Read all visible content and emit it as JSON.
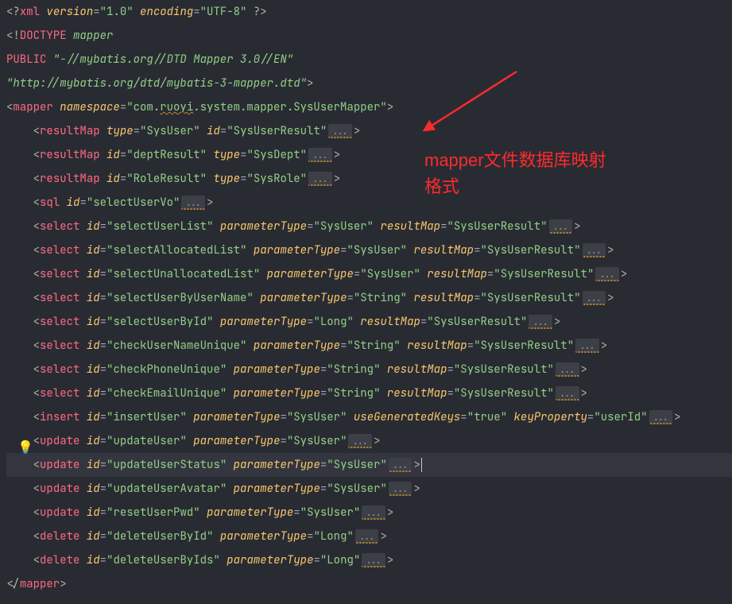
{
  "annotation": {
    "text_line1": "mapper文件数据库映射",
    "text_line2": "格式"
  },
  "bulb": "💡",
  "code": {
    "l1": {
      "pre": "<?",
      "tag": "xml",
      "a1": "version",
      "v1": "\"1.0\"",
      "a2": "encoding",
      "v2": "\"UTF-8\"",
      "post": " ?>"
    },
    "l2": {
      "open": "<!",
      "kw": "DOCTYPE",
      "val": "mapper"
    },
    "l3": {
      "kw": "PUBLIC",
      "val": "\"-//mybatis.org//DTD Mapper 3.0//EN\""
    },
    "l4": {
      "val": "\"http://mybatis.org/dtd/mybatis-3-mapper.dtd\"",
      "close": ">"
    },
    "l5": {
      "open": "<",
      "tag": "mapper",
      "a1": "namespace",
      "v1p": "\"com.",
      "v1w": "ruoyi",
      "v1s": ".system.mapper.SysUserMapper\"",
      "close": ">"
    },
    "l6": {
      "tag": "resultMap",
      "a1": "type",
      "v1": "\"SysUser\"",
      "a2": "id",
      "v2": "\"SysUserResult\"",
      "fold": "..."
    },
    "l7": {
      "tag": "resultMap",
      "a1": "id",
      "v1": "\"deptResult\"",
      "a2": "type",
      "v2": "\"SysDept\"",
      "fold": "..."
    },
    "l8": {
      "tag": "resultMap",
      "a1": "id",
      "v1": "\"RoleResult\"",
      "a2": "type",
      "v2": "\"SysRole\"",
      "fold": "..."
    },
    "l9": {
      "tag": "sql",
      "a1": "id",
      "v1": "\"selectUserVo\"",
      "fold": "..."
    },
    "l10": {
      "tag": "select",
      "a1": "id",
      "v1": "\"selectUserList\"",
      "a2": "parameterType",
      "v2": "\"SysUser\"",
      "a3": "resultMap",
      "v3": "\"SysUserResult\"",
      "fold": "..."
    },
    "l11": {
      "tag": "select",
      "a1": "id",
      "v1": "\"selectAllocatedList\"",
      "a2": "parameterType",
      "v2": "\"SysUser\"",
      "a3": "resultMap",
      "v3": "\"SysUserResult\"",
      "fold": "..."
    },
    "l12": {
      "tag": "select",
      "a1": "id",
      "v1": "\"selectUnallocatedList\"",
      "a2": "parameterType",
      "v2": "\"SysUser\"",
      "a3": "resultMap",
      "v3": "\"SysUserResult\"",
      "fold": "..."
    },
    "l13": {
      "tag": "select",
      "a1": "id",
      "v1": "\"selectUserByUserName\"",
      "a2": "parameterType",
      "v2": "\"String\"",
      "a3": "resultMap",
      "v3": "\"SysUserResult\"",
      "fold": "..."
    },
    "l14": {
      "tag": "select",
      "a1": "id",
      "v1": "\"selectUserById\"",
      "a2": "parameterType",
      "v2": "\"Long\"",
      "a3": "resultMap",
      "v3": "\"SysUserResult\"",
      "fold": "..."
    },
    "l15": {
      "tag": "select",
      "a1": "id",
      "v1": "\"checkUserNameUnique\"",
      "a2": "parameterType",
      "v2": "\"String\"",
      "a3": "resultMap",
      "v3": "\"SysUserResult\"",
      "fold": "..."
    },
    "l16": {
      "tag": "select",
      "a1": "id",
      "v1": "\"checkPhoneUnique\"",
      "a2": "parameterType",
      "v2": "\"String\"",
      "a3": "resultMap",
      "v3": "\"SysUserResult\"",
      "fold": "..."
    },
    "l17": {
      "tag": "select",
      "a1": "id",
      "v1": "\"checkEmailUnique\"",
      "a2": "parameterType",
      "v2": "\"String\"",
      "a3": "resultMap",
      "v3": "\"SysUserResult\"",
      "fold": "..."
    },
    "l18": {
      "tag": "insert",
      "a1": "id",
      "v1": "\"insertUser\"",
      "a2": "parameterType",
      "v2": "\"SysUser\"",
      "a3": "useGeneratedKeys",
      "v3": "\"true\"",
      "a4": "keyProperty",
      "v4": "\"userId\"",
      "fold": "..."
    },
    "l19": {
      "tag": "update",
      "a1": "id",
      "v1": "\"updateUser\"",
      "a2": "parameterType",
      "v2": "\"SysUser\"",
      "fold": "..."
    },
    "l20": {
      "tag": "update",
      "a1": "id",
      "v1": "\"updateUserStatus\"",
      "a2": "parameterType",
      "v2": "\"SysUser\"",
      "fold": "..."
    },
    "l21": {
      "tag": "update",
      "a1": "id",
      "v1": "\"updateUserAvatar\"",
      "a2": "parameterType",
      "v2": "\"SysUser\"",
      "fold": "..."
    },
    "l22": {
      "tag": "update",
      "a1": "id",
      "v1": "\"resetUserPwd\"",
      "a2": "parameterType",
      "v2": "\"SysUser\"",
      "fold": "..."
    },
    "l23": {
      "tag": "delete",
      "a1": "id",
      "v1": "\"deleteUserById\"",
      "a2": "parameterType",
      "v2": "\"Long\"",
      "fold": "..."
    },
    "l24": {
      "tag": "delete",
      "a1": "id",
      "v1": "\"deleteUserByIds\"",
      "a2": "parameterType",
      "v2": "\"Long\"",
      "fold": "..."
    },
    "l25": {
      "open": "</",
      "tag": "mapper",
      "close": ">"
    }
  }
}
